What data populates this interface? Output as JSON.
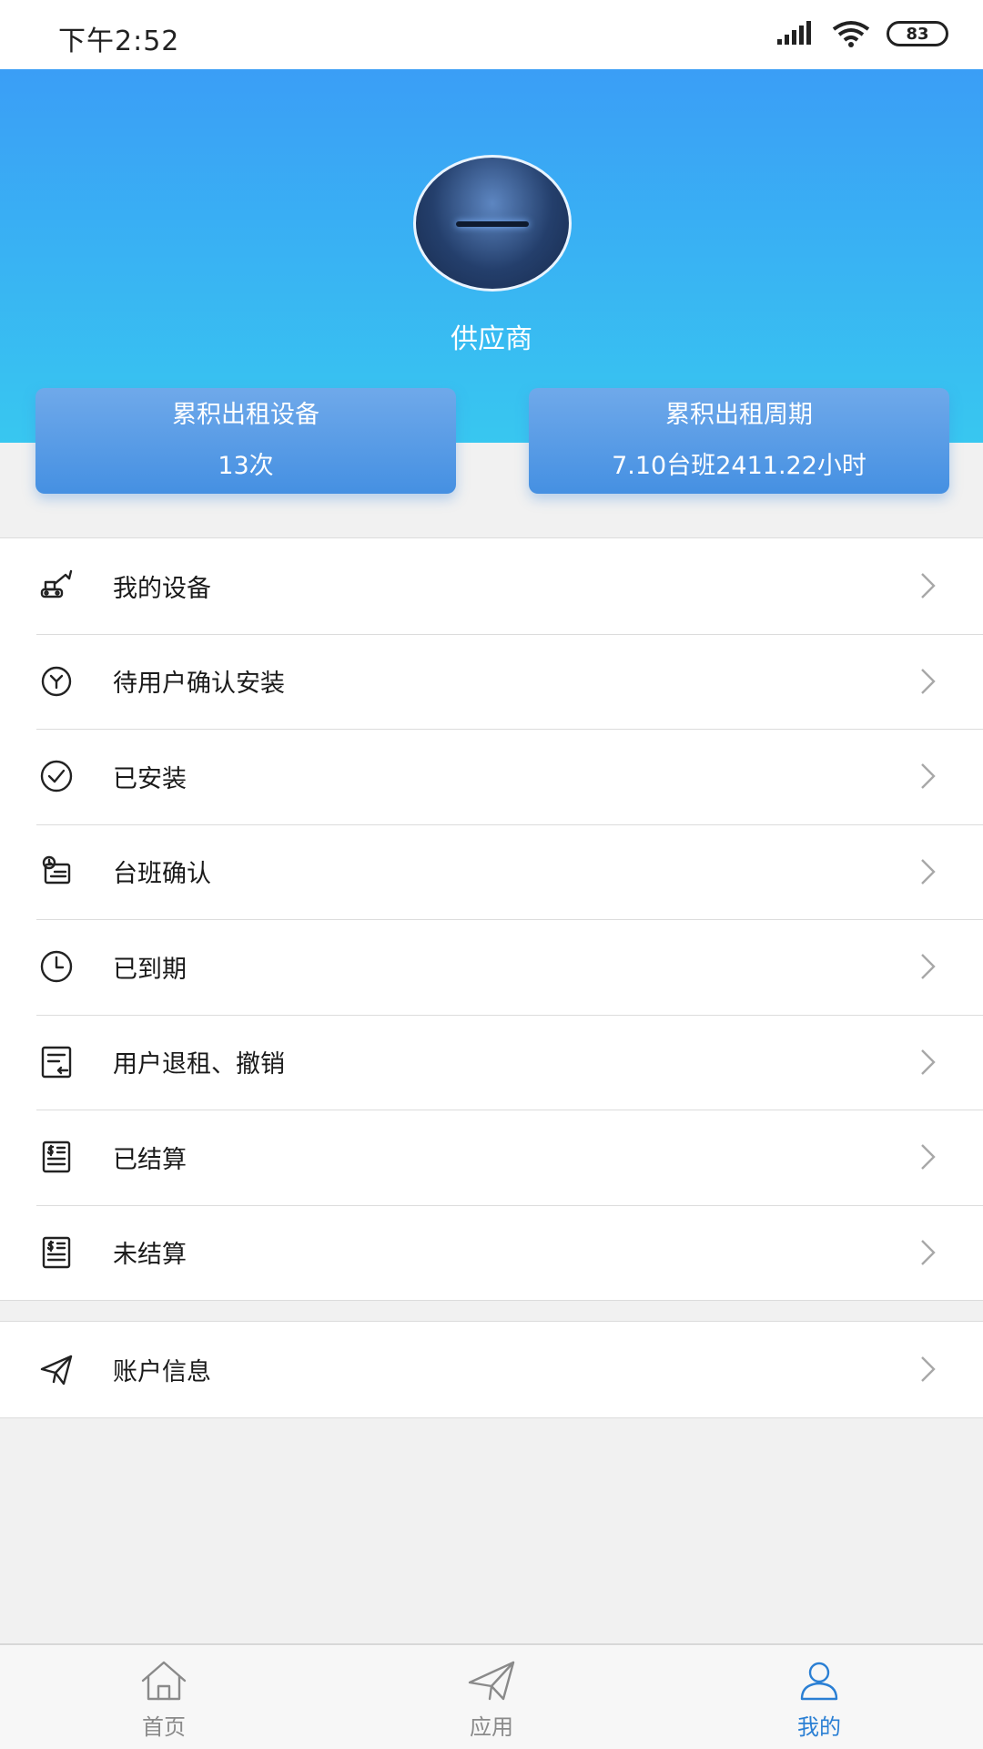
{
  "status_bar": {
    "time": "下午2:52",
    "battery": "83"
  },
  "profile": {
    "role": "供应商"
  },
  "stats": [
    {
      "title": "累积出租设备",
      "value": "13次"
    },
    {
      "title": "累积出租周期",
      "value": "7.10台班2411.22小时"
    }
  ],
  "menu": [
    {
      "label": "我的设备",
      "icon": "excavator-icon"
    },
    {
      "label": "待用户确认安装",
      "icon": "wrench-circle-icon"
    },
    {
      "label": "已安装",
      "icon": "check-circle-icon"
    },
    {
      "label": "台班确认",
      "icon": "shift-confirm-icon"
    },
    {
      "label": "已到期",
      "icon": "clock-icon"
    },
    {
      "label": "用户退租、撤销",
      "icon": "return-document-icon"
    },
    {
      "label": "已结算",
      "icon": "settled-bill-icon"
    },
    {
      "label": "未结算",
      "icon": "unsettled-bill-icon"
    }
  ],
  "account": {
    "label": "账户信息",
    "icon": "paper-plane-icon"
  },
  "tabs": [
    {
      "label": "首页",
      "icon": "home-icon",
      "active": false
    },
    {
      "label": "应用",
      "icon": "paper-plane-icon",
      "active": false
    },
    {
      "label": "我的",
      "icon": "user-icon",
      "active": true
    }
  ],
  "colors": {
    "header_top": "#3a9ef6",
    "header_bottom": "#38c7f0",
    "card": "#4590e2",
    "active_tab": "#2a7fd4"
  }
}
